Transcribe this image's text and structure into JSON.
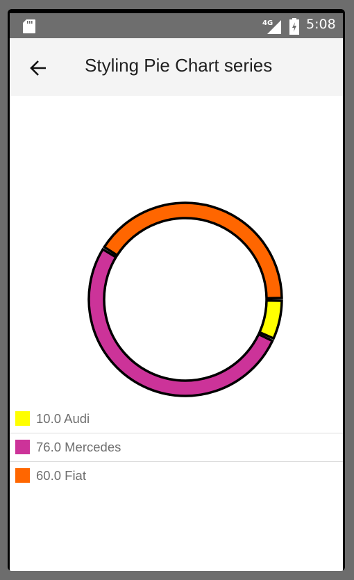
{
  "status_bar": {
    "network": "4G",
    "time": "5:08"
  },
  "app_bar": {
    "title": "Styling Pie Chart series",
    "back_icon": "arrow-back-icon"
  },
  "chart_data": {
    "type": "pie",
    "style": "donut",
    "categories": [
      "Audi",
      "Mercedes",
      "Fiat"
    ],
    "values": [
      10.0,
      76.0,
      60.0
    ],
    "colors": [
      "#ffff00",
      "#cc3399",
      "#ff6600"
    ],
    "stroke_color": "#000000"
  },
  "legend": {
    "items": [
      {
        "label": "10.0 Audi",
        "color": "#ffff00"
      },
      {
        "label": "76.0 Mercedes",
        "color": "#cc3399"
      },
      {
        "label": "60.0 Fiat",
        "color": "#ff6600"
      }
    ]
  }
}
